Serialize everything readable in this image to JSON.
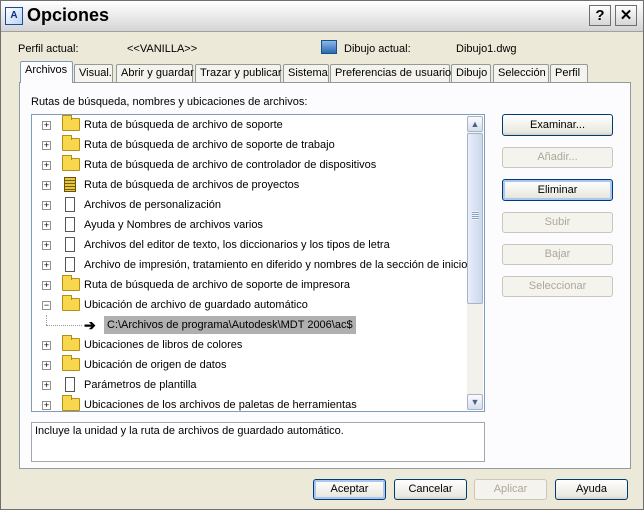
{
  "window": {
    "title": "Opciones",
    "app_icon_text": "A",
    "help_label": "?",
    "close_label": "✕"
  },
  "profile": {
    "label": "Perfil actual:",
    "value": "<<VANILLA>>"
  },
  "drawing": {
    "label": "Dibujo actual:",
    "value": "Dibujo1.dwg"
  },
  "tabs": [
    {
      "label": "Archivos",
      "active": true
    },
    {
      "label": "Visual."
    },
    {
      "label": "Abrir y guardar"
    },
    {
      "label": "Trazar y publicar"
    },
    {
      "label": "Sistema"
    },
    {
      "label": "Preferencias de usuario"
    },
    {
      "label": "Dibujo"
    },
    {
      "label": "Selección"
    },
    {
      "label": "Perfil"
    }
  ],
  "section_label": "Rutas de búsqueda, nombres y ubicaciones de archivos:",
  "tree": [
    {
      "label": "Ruta de búsqueda de archivo de soporte",
      "icon": "folder",
      "expander": "+"
    },
    {
      "label": "Ruta de búsqueda de archivo de soporte de trabajo",
      "icon": "folder",
      "expander": "+"
    },
    {
      "label": "Ruta de búsqueda de archivo de controlador de dispositivos",
      "icon": "folder",
      "expander": "+"
    },
    {
      "label": "Ruta de búsqueda de archivos de proyectos",
      "icon": "project-file",
      "expander": "+"
    },
    {
      "label": "Archivos de personalización",
      "icon": "document",
      "expander": "+"
    },
    {
      "label": "Ayuda y Nombres de archivos varios",
      "icon": "document",
      "expander": "+"
    },
    {
      "label": "Archivos del editor de texto, los diccionarios y los tipos de letra",
      "icon": "document",
      "expander": "+"
    },
    {
      "label": "Archivo de impresión, tratamiento en diferido y nombres de la sección de inicio",
      "icon": "document",
      "expander": "+"
    },
    {
      "label": "Ruta de búsqueda de archivo de soporte de impresora",
      "icon": "folder",
      "expander": "+"
    },
    {
      "label": "Ubicación de archivo de guardado automático",
      "icon": "folder-open",
      "expander": "−",
      "expanded": true
    },
    {
      "label": "C:\\Archivos de programa\\Autodesk\\MDT 2006\\ac$",
      "icon": "arrow",
      "selected": true
    },
    {
      "label": "Ubicaciones de libros de colores",
      "icon": "folder",
      "expander": "+"
    },
    {
      "label": "Ubicación de origen de datos",
      "icon": "folder",
      "expander": "+"
    },
    {
      "label": "Parámetros de plantilla",
      "icon": "document",
      "expander": "+"
    },
    {
      "label": "Ubicaciones de los archivos de paletas de herramientas",
      "icon": "folder",
      "expander": "+"
    }
  ],
  "side_buttons": {
    "browse": "Examinar...",
    "add": "Añadir...",
    "remove": "Eliminar",
    "move_up": "Subir",
    "move_down": "Bajar",
    "select": "Seleccionar"
  },
  "description": "Incluye la unidad y la ruta de archivos de guardado automático.",
  "footer_buttons": {
    "ok": "Aceptar",
    "cancel": "Cancelar",
    "apply": "Aplicar",
    "help": "Ayuda"
  },
  "colors": {
    "selection_bg": "#b0b0b0",
    "button_border": "#003c74",
    "folder": "#f8d74c"
  }
}
